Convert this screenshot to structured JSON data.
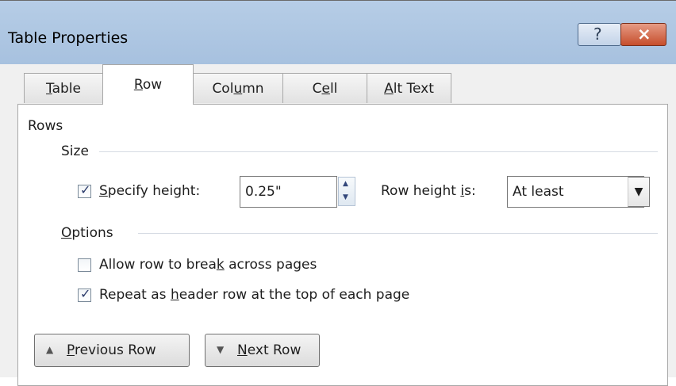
{
  "window": {
    "title": "Table Properties"
  },
  "title_buttons": {
    "help": "?",
    "close": "×"
  },
  "tabs": [
    {
      "label": "Table",
      "underline": 0
    },
    {
      "label": "Row",
      "underline": 0
    },
    {
      "label": "Column",
      "underline": 3
    },
    {
      "label": "Cell",
      "underline": 1
    },
    {
      "label": "Alt Text",
      "underline": 0
    }
  ],
  "active_tab": "Row",
  "rows_section": {
    "label": "Rows"
  },
  "size_section": {
    "label": "Size"
  },
  "specify_height": {
    "label": "Specify height:",
    "checked": true,
    "value": "0.25\""
  },
  "row_height_is": {
    "label": "Row height is:",
    "selected": "At least"
  },
  "options_section": {
    "label": "Options"
  },
  "allow_break": {
    "label": "Allow row to break across pages",
    "checked": false
  },
  "repeat_header": {
    "label": "Repeat as header row at the top of each page",
    "checked": true
  },
  "buttons": {
    "previous_row": "Previous Row",
    "next_row": "Next Row"
  },
  "colors": {
    "titlebar": "#a7c1df",
    "close": "#c64e2c",
    "panel": "#ffffff",
    "dialog_bg": "#f0f0f0"
  }
}
